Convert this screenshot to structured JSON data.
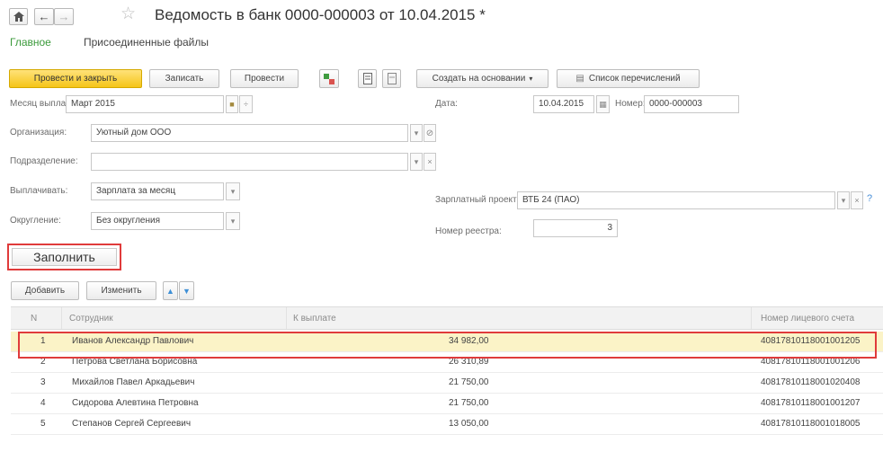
{
  "window": {
    "title": "Ведомость в банк 0000-000003 от 10.04.2015 *"
  },
  "tabs": [
    {
      "label": "Главное",
      "active": true
    },
    {
      "label": "Присоединенные файлы",
      "active": false
    }
  ],
  "toolbar": {
    "post_close": "Провести и закрыть",
    "save": "Записать",
    "post": "Провести",
    "create_based": "Создать на основании",
    "transfer_list": "Список перечислений"
  },
  "form": {
    "month_label": "Месяц выплаты:",
    "month_value": "Март 2015",
    "date_label": "Дата:",
    "date_value": "10.04.2015",
    "number_label": "Номер:",
    "number_value": "0000-000003",
    "org_label": "Организация:",
    "org_value": "Уютный дом ООО",
    "dept_label": "Подразделение:",
    "dept_value": "",
    "pay_label": "Выплачивать:",
    "pay_value": "Зарплата за месяц",
    "round_label": "Округление:",
    "round_value": "Без округления",
    "project_label": "Зарплатный проект:",
    "project_value": "ВТБ 24 (ПАО)",
    "registry_label": "Номер реестра:",
    "registry_value": "3"
  },
  "fill_button": "Заполнить",
  "table_toolbar": {
    "add": "Добавить",
    "edit": "Изменить"
  },
  "table": {
    "columns": [
      "N",
      "Сотрудник",
      "К выплате",
      "Номер лицевого счета"
    ],
    "rows": [
      {
        "n": "1",
        "employee": "Иванов Александр Павлович",
        "amount": "34 982,00",
        "account": "40817810118001001205"
      },
      {
        "n": "2",
        "employee": "Петрова Светлана Борисовна",
        "amount": "26 310,89",
        "account": "40817810118001001206"
      },
      {
        "n": "3",
        "employee": "Михайлов Павел Аркадьевич",
        "amount": "21 750,00",
        "account": "40817810118001020408"
      },
      {
        "n": "4",
        "employee": "Сидорова Алевтина Петровна",
        "amount": "21 750,00",
        "account": "40817810118001001207"
      },
      {
        "n": "5",
        "employee": "Степанов Сергей Сергеевич",
        "amount": "13 050,00",
        "account": "40817810118001018005"
      }
    ]
  },
  "colors": {
    "accent_green": "#3a9a3a",
    "primary_yellow": "#f5c518",
    "highlight_red": "#e03b3b",
    "selected_row": "#fbf3c7"
  },
  "icons": [
    "home-icon",
    "back-arrow-icon",
    "forward-arrow-icon",
    "star-icon",
    "calendar-icon",
    "open-link-icon",
    "up-arrow-icon",
    "down-arrow-icon"
  ]
}
